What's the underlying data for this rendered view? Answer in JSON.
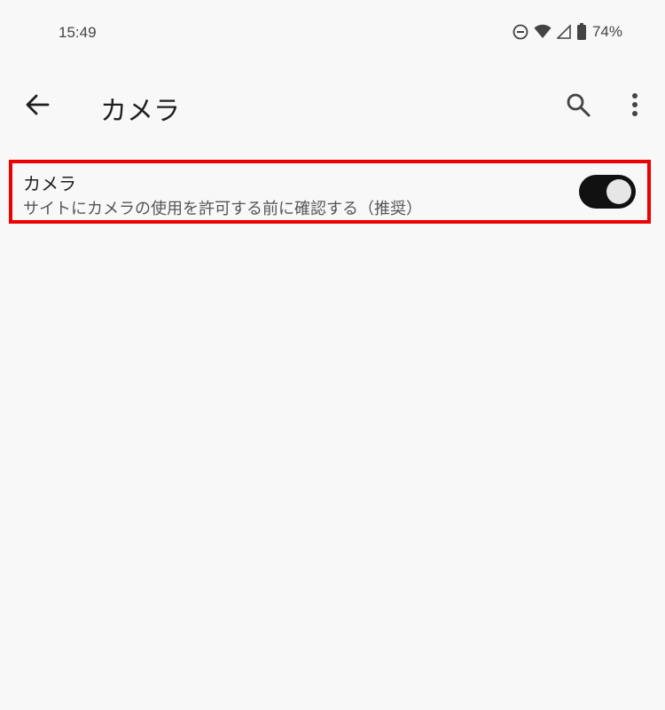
{
  "status_bar": {
    "time": "15:49",
    "battery_percent": "74%",
    "icons": [
      "do-not-disturb-icon",
      "wifi-icon",
      "cellular-signal-icon",
      "battery-icon"
    ]
  },
  "app_bar": {
    "title": "カメラ",
    "icons": [
      "back-arrow-icon",
      "search-icon",
      "more-vert-icon"
    ]
  },
  "setting": {
    "title": "カメラ",
    "summary": "サイトにカメラの使用を許可する前に確認する（推奨）",
    "toggle_on": true
  },
  "colors": {
    "background": "#f8f8f8",
    "highlight_border": "#ee0000",
    "toggle_track": "#111111",
    "toggle_knob": "#e6e6e6"
  }
}
